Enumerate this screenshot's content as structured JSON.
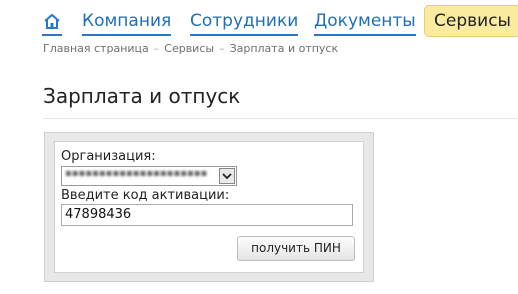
{
  "nav": {
    "items": [
      {
        "label": "Компания"
      },
      {
        "label": "Сотрудники"
      },
      {
        "label": "Документы"
      }
    ],
    "active_label": "Сервисы"
  },
  "breadcrumb": [
    "Главная страница",
    "Сервисы",
    "Зарплата и отпуск"
  ],
  "page": {
    "title": "Зарплата и отпуск"
  },
  "form": {
    "org_label": "Организация:",
    "code_label": "Введите код активации:",
    "code_value": "47898436",
    "button_label": "получить ПИН"
  },
  "colors": {
    "link": "#1f6fb8",
    "active_tab_bg": "#fbeba0"
  }
}
